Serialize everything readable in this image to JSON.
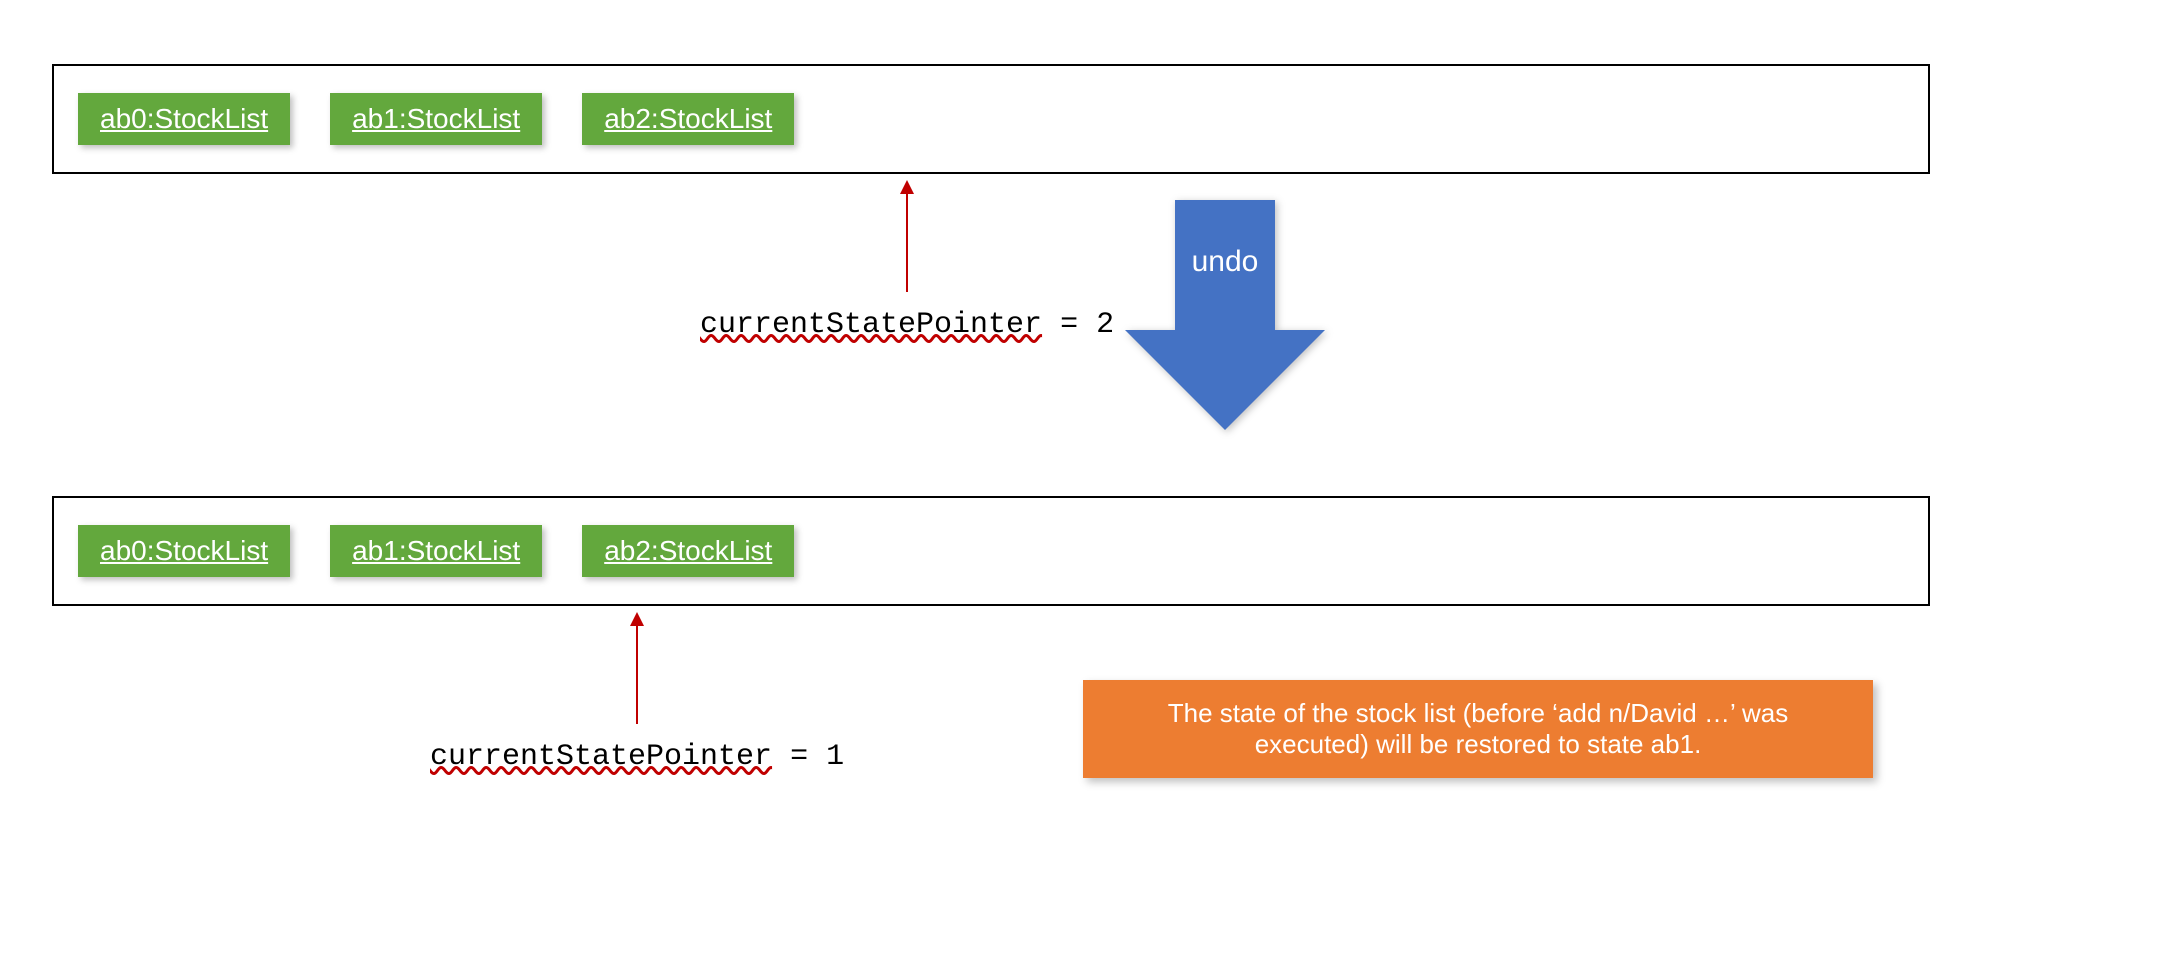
{
  "top_list": {
    "states": [
      "ab0:StockList",
      "ab1:StockList",
      "ab2:StockList"
    ]
  },
  "bottom_list": {
    "states": [
      "ab0:StockList",
      "ab1:StockList",
      "ab2:StockList"
    ]
  },
  "top_pointer": {
    "var": "currentStatePointer",
    "value": " = 2"
  },
  "bottom_pointer": {
    "var": "currentStatePointer",
    "value": " = 1"
  },
  "undo_arrow": {
    "label": "undo",
    "color": "#4472c4"
  },
  "note": {
    "text": "The state of the stock list (before ‘add n/David …’ was executed) will be restored to state ab1.",
    "color": "#ed7d31"
  }
}
